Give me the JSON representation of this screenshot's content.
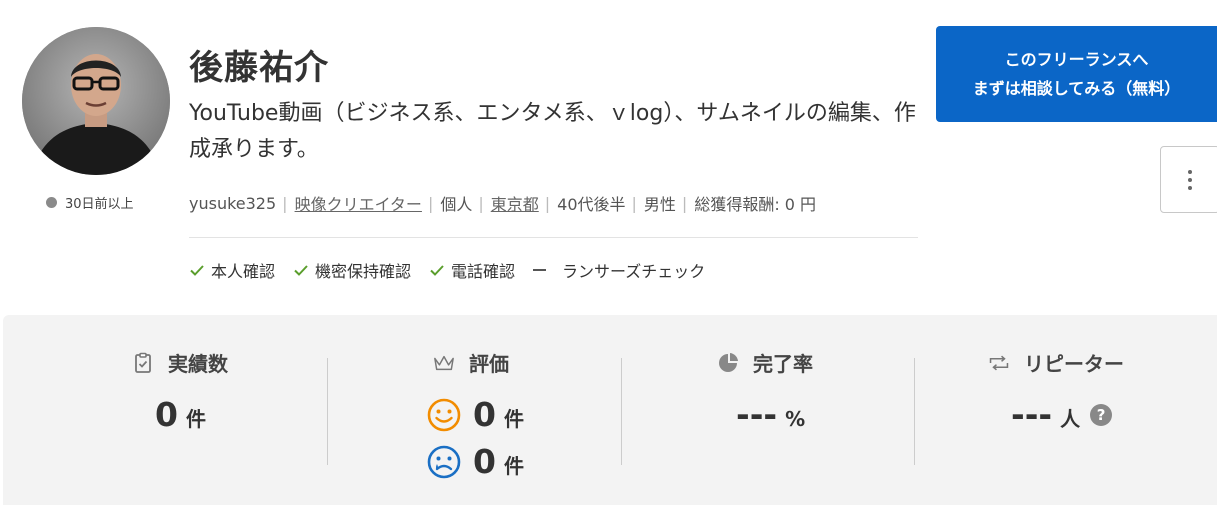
{
  "profile": {
    "name": "後藤祐介",
    "catchphrase": "YouTube動画（ビジネス系、エンタメ系、ｖlog）、サムネイルの編集、作成承ります。",
    "online_status": "30日前以上",
    "username": "yusuke325",
    "occupation": "映像クリエイター",
    "type": "個人",
    "location": "東京都",
    "age": "40代後半",
    "gender": "男性",
    "total_earnings": "総獲得報酬: 0 円"
  },
  "verifications": [
    {
      "label": "本人確認",
      "verified": true
    },
    {
      "label": "機密保持確認",
      "verified": true
    },
    {
      "label": "電話確認",
      "verified": true
    },
    {
      "label": "ランサーズチェック",
      "verified": false
    }
  ],
  "actions": {
    "consult_line1": "このフリーランスへ",
    "consult_line2": "まずは相談してみる（無料）"
  },
  "stats": {
    "results": {
      "label": "実績数",
      "value": "0",
      "unit": "件"
    },
    "rating": {
      "label": "評価",
      "good": "0",
      "bad": "0",
      "unit": "件"
    },
    "completion": {
      "label": "完了率",
      "value": "---",
      "unit": "%"
    },
    "repeater": {
      "label": "リピーター",
      "value": "---",
      "unit": "人",
      "help": "?"
    }
  },
  "colors": {
    "primary_button": "#0b66c7",
    "check_green": "#5a9e2c",
    "good_face": "#f28c00",
    "bad_face": "#1a6fc4"
  }
}
